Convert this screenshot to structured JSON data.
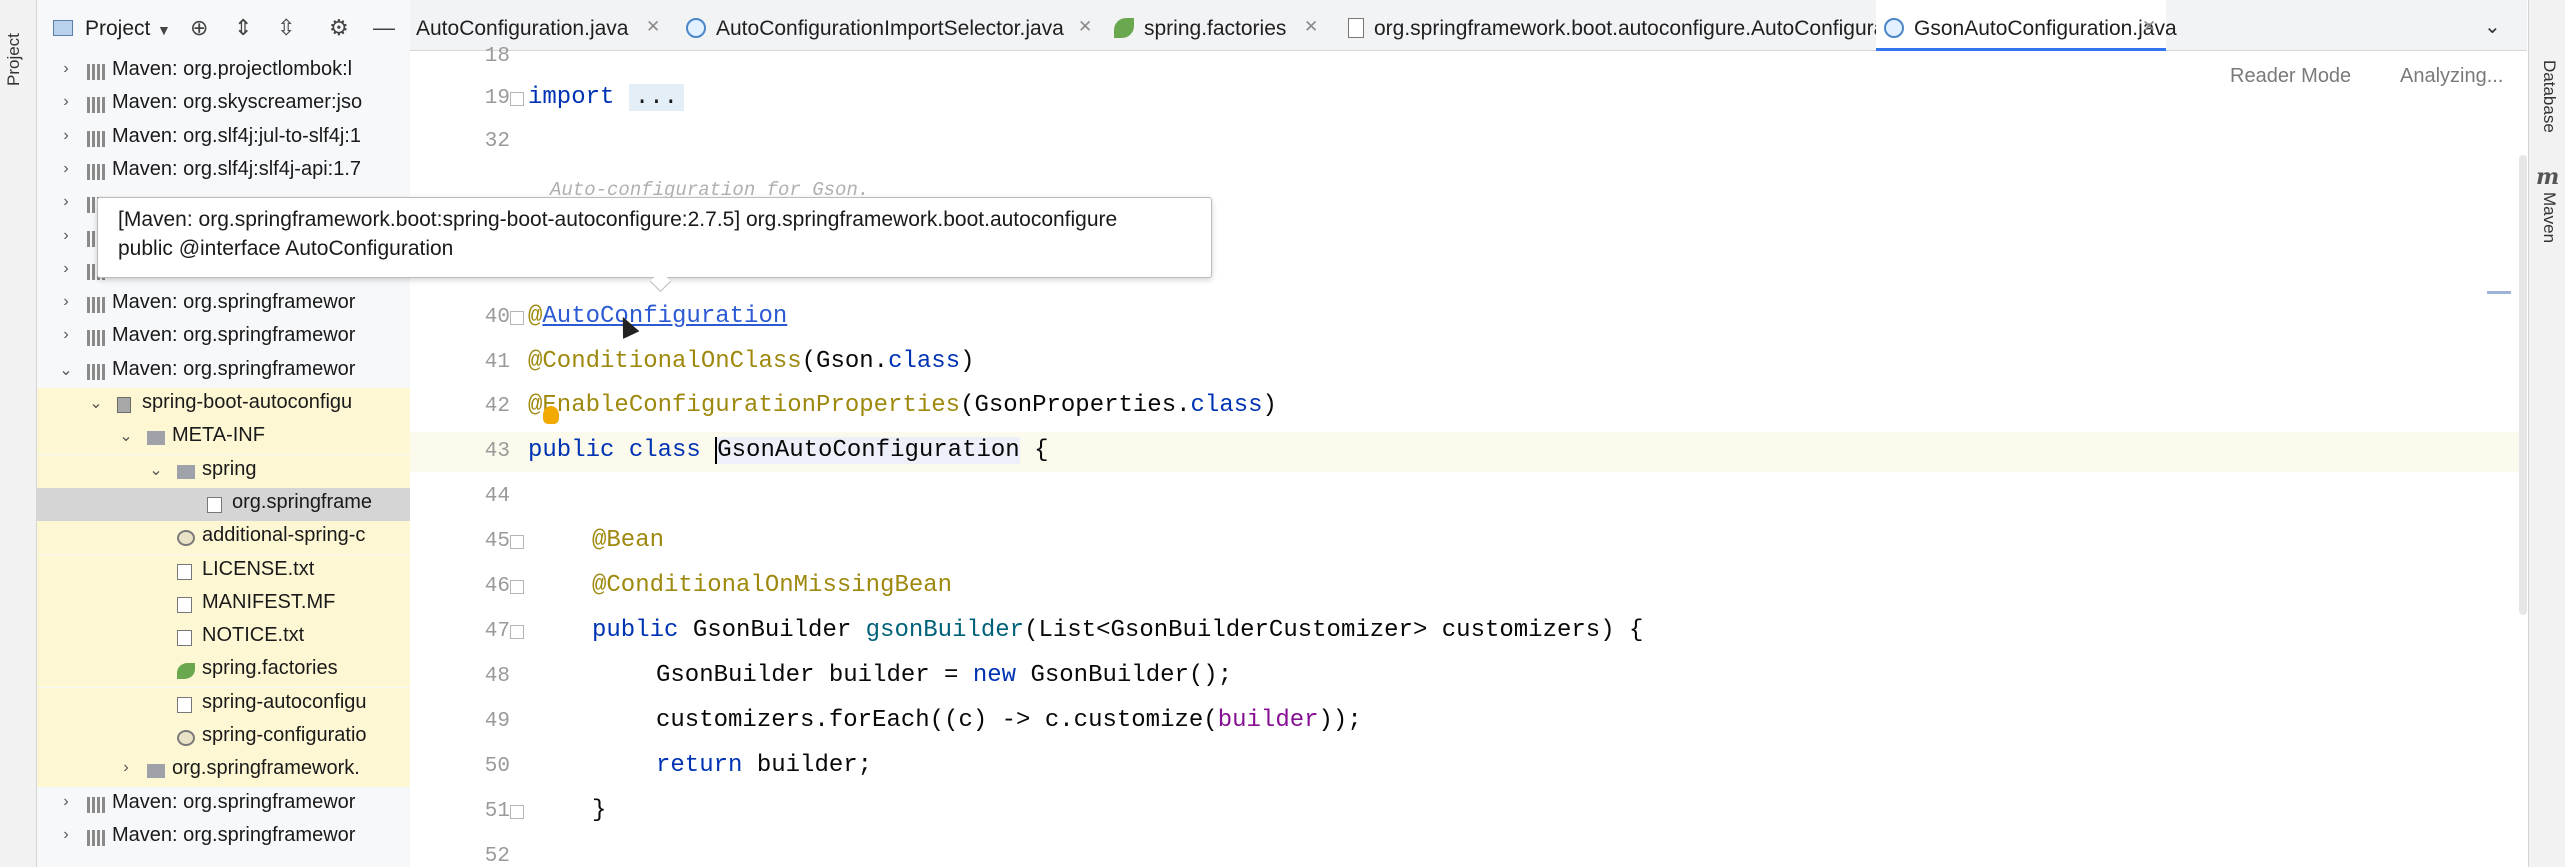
{
  "side_tabs": {
    "left": "Project",
    "right_top": "Database",
    "right_bottom": "Maven"
  },
  "project_panel": {
    "title": "Project",
    "tree": [
      {
        "label": "Maven: org.projectlombok:l",
        "depth": 1,
        "expander": "collapsed",
        "icon": "library-icon",
        "highlight": false
      },
      {
        "label": "Maven: org.skyscreamer:jso",
        "depth": 1,
        "expander": "collapsed",
        "icon": "library-icon",
        "highlight": false
      },
      {
        "label": "Maven: org.slf4j:jul-to-slf4j:1",
        "depth": 1,
        "expander": "collapsed",
        "icon": "library-icon",
        "highlight": false
      },
      {
        "label": "Maven: org.slf4j:slf4j-api:1.7",
        "depth": 1,
        "expander": "collapsed",
        "icon": "library-icon",
        "highlight": false
      },
      {
        "label": "",
        "depth": 1,
        "expander": "collapsed",
        "icon": "library-icon",
        "highlight": false
      },
      {
        "label": "",
        "depth": 1,
        "expander": "collapsed",
        "icon": "library-icon",
        "highlight": false
      },
      {
        "label": "",
        "depth": 1,
        "expander": "collapsed",
        "icon": "library-icon",
        "highlight": false
      },
      {
        "label": "Maven: org.springframewor",
        "depth": 1,
        "expander": "collapsed",
        "icon": "library-icon",
        "highlight": false
      },
      {
        "label": "Maven: org.springframewor",
        "depth": 1,
        "expander": "collapsed",
        "icon": "library-icon",
        "highlight": false
      },
      {
        "label": "Maven: org.springframewor",
        "depth": 1,
        "expander": "expanded",
        "icon": "library-icon",
        "highlight": false
      },
      {
        "label": "spring-boot-autoconfigu",
        "depth": 2,
        "expander": "expanded",
        "icon": "jar-icon",
        "highlight": true
      },
      {
        "label": "META-INF",
        "depth": 3,
        "expander": "expanded",
        "icon": "folder-icon",
        "highlight": true
      },
      {
        "label": "spring",
        "depth": 4,
        "expander": "expanded",
        "icon": "folder-icon",
        "highlight": true
      },
      {
        "label": "org.springframe",
        "depth": 5,
        "expander": "none",
        "icon": "file-icon",
        "highlight": true,
        "selected": true
      },
      {
        "label": "additional-spring-c",
        "depth": 4,
        "expander": "none",
        "icon": "config-file-icon",
        "highlight": true
      },
      {
        "label": "LICENSE.txt",
        "depth": 4,
        "expander": "none",
        "icon": "file-icon",
        "highlight": true
      },
      {
        "label": "MANIFEST.MF",
        "depth": 4,
        "expander": "none",
        "icon": "file-icon",
        "highlight": true
      },
      {
        "label": "NOTICE.txt",
        "depth": 4,
        "expander": "none",
        "icon": "file-icon",
        "highlight": true
      },
      {
        "label": "spring.factories",
        "depth": 4,
        "expander": "none",
        "icon": "spring-icon",
        "highlight": true
      },
      {
        "label": "spring-autoconfigu",
        "depth": 4,
        "expander": "none",
        "icon": "file-icon",
        "highlight": true
      },
      {
        "label": "spring-configuratio",
        "depth": 4,
        "expander": "none",
        "icon": "config-file-icon",
        "highlight": true
      },
      {
        "label": "org.springframework.",
        "depth": 3,
        "expander": "collapsed",
        "icon": "folder-icon",
        "highlight": true
      },
      {
        "label": "Maven: org.springframewor",
        "depth": 1,
        "expander": "collapsed",
        "icon": "library-icon",
        "highlight": false
      },
      {
        "label": "Maven: org.springframewor",
        "depth": 1,
        "expander": "collapsed",
        "icon": "library-icon",
        "highlight": false
      }
    ]
  },
  "tabs": [
    {
      "label": "AutoConfiguration.java",
      "icon": "none",
      "active": false
    },
    {
      "label": "AutoConfigurationImportSelector.java",
      "icon": "class-icon",
      "active": false
    },
    {
      "label": "spring.factories",
      "icon": "spring-icon",
      "active": false
    },
    {
      "label": "org.springframework.boot.autoconfigure.AutoConfiguration.imports",
      "icon": "text-file-icon",
      "active": false
    },
    {
      "label": "GsonAutoConfiguration.java",
      "icon": "class-icon",
      "active": true
    }
  ],
  "editor": {
    "reader_mode": "Reader Mode",
    "analyzing": "Analyzing...",
    "line_numbers": [
      "18",
      "19",
      "32",
      "40",
      "41",
      "42",
      "43",
      "44",
      "45",
      "46",
      "47",
      "48",
      "49",
      "50",
      "51",
      "52"
    ],
    "comment_peek": "Auto-configuration for Gson.",
    "code": {
      "import_kw": "import",
      "import_dots": "...",
      "l40_at": "@",
      "l40_ann": "AutoConfiguration",
      "l41_ann": "@ConditionalOnClass",
      "l41_arg": "(Gson.",
      "l41_cls": "class",
      "l41_end": ")",
      "l42_ann": "@EnableConfigurationProperties",
      "l42_arg": "(GsonProperties.",
      "l42_cls": "class",
      "l42_end": ")",
      "l43_kw": "public class ",
      "l43_name": "GsonAutoConfiguration",
      "l43_end": " {",
      "l45_ann": "@Bean",
      "l46_ann": "@ConditionalOnMissingBean",
      "l47_kw": "public ",
      "l47_type": "GsonBuilder ",
      "l47_fn": "gsonBuilder",
      "l47_rest": "(List<GsonBuilderCustomizer> customizers) {",
      "l48_a": "GsonBuilder builder = ",
      "l48_kw": "new ",
      "l48_b": "GsonBuilder();",
      "l49_a": "customizers.forEach((c) -> c.customize(",
      "l49_p": "builder",
      "l49_b": "));",
      "l50_kw": "return ",
      "l50_b": "builder;",
      "l51": "}"
    }
  },
  "tooltip": {
    "line1": "[Maven: org.springframework.boot:spring-boot-autoconfigure:2.7.5] org.springframework.boot.autoconfigure",
    "line2": "public @interface AutoConfiguration"
  }
}
